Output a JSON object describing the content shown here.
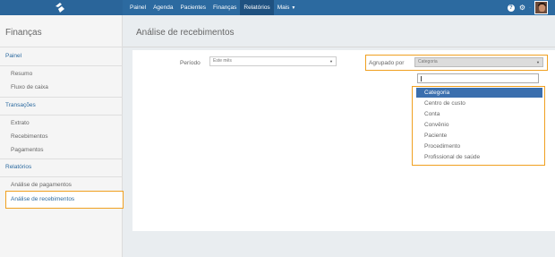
{
  "topbar": {
    "logo_icon": "app-logo-icon",
    "nav": [
      {
        "label": "Painel"
      },
      {
        "label": "Agenda"
      },
      {
        "label": "Pacientes"
      },
      {
        "label": "Finanças"
      },
      {
        "label": "Relatórios",
        "active": true
      },
      {
        "label": "Mais"
      }
    ],
    "help_icon": "help-icon",
    "gear_icon": "gear-icon"
  },
  "sidebar": {
    "title": "Finanças",
    "sections": [
      {
        "label": "Painel",
        "items": [
          "Resumo",
          "Fluxo de caixa"
        ]
      },
      {
        "label": "Transações",
        "items": [
          "Extrato",
          "Recebimentos",
          "Pagamentos"
        ]
      },
      {
        "label": "Relatórios",
        "items": [
          "Análise de pagamentos",
          "Análise de recebimentos"
        ]
      }
    ]
  },
  "main": {
    "title": "Análise de recebimentos",
    "periodo_label": "Período",
    "periodo_value": "Este mês",
    "agrupado_label": "Agrupado por",
    "agrupado_value": "Categoria",
    "dropdown": {
      "search_value": "",
      "options": [
        "Categoria",
        "Centro de custo",
        "Conta",
        "Convênio",
        "Paciente",
        "Procedimento",
        "Profissional de saúde"
      ],
      "selected": "Categoria"
    }
  },
  "colors": {
    "topbar": "#2c6aa0",
    "highlight": "#f0a020",
    "selected_option": "#3b6fae"
  }
}
